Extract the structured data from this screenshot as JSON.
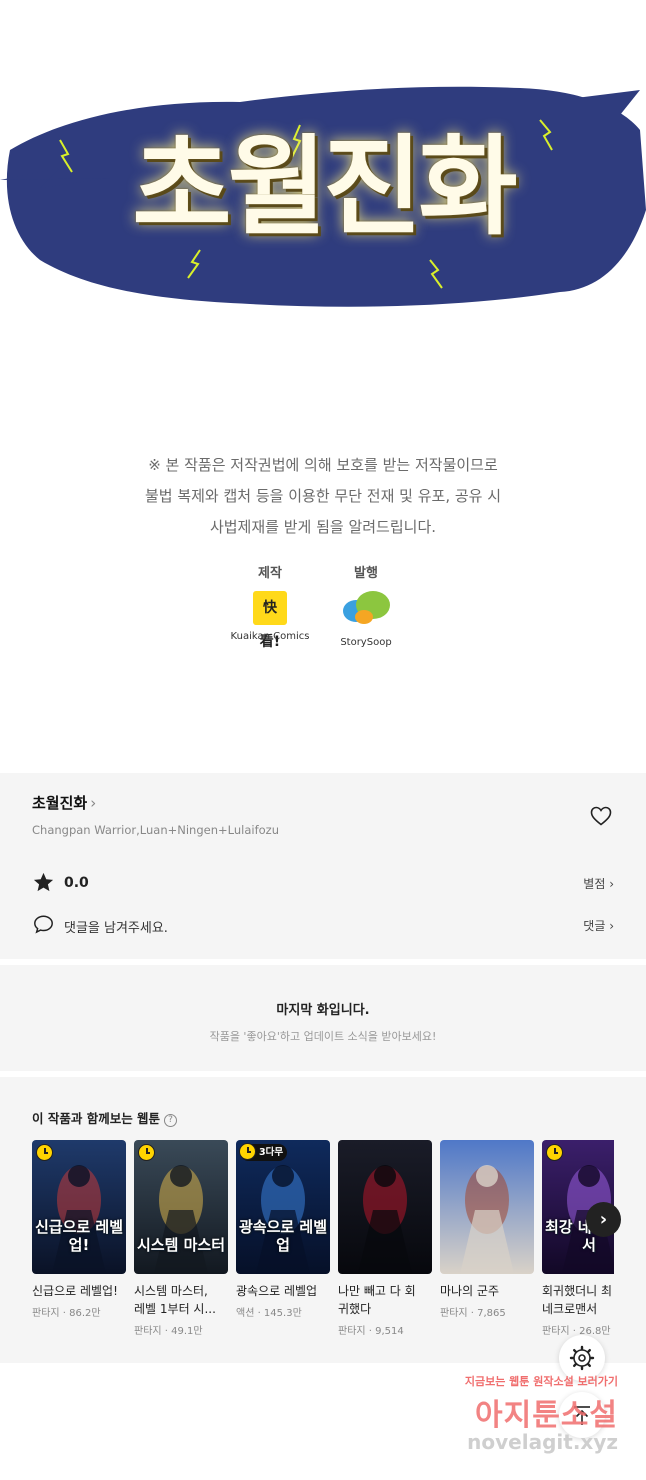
{
  "banner": {
    "title": "초월진화"
  },
  "notice": {
    "lines": [
      "※ 본 작품은 저작권법에 의해 보호를 받는 저작물이므로",
      "불법 복제와 캡처 등을 이용한 무단 전재 및 유포, 공유 시",
      "사법제재를 받게 됨을 알려드립니다."
    ]
  },
  "credits": {
    "production_label": "제작",
    "production_logo_text": "快看!",
    "production_name": "Kuaikan Comics",
    "publisher_label": "발행",
    "publisher_name": "StorySoop"
  },
  "info": {
    "series_title": "초월진화",
    "chevron": "›",
    "authors": "Changpan Warrior,Luan+Ningen+Lulaifozu",
    "rating": "0.0",
    "rate_link": "별점 ›",
    "comment_prompt": "댓글을 남겨주세요.",
    "comment_link": "댓글 ›"
  },
  "last_episode": {
    "title": "마지막 화입니다.",
    "subtitle": "작품을 '좋아요'하고 업데이트 소식을 받아보세요!"
  },
  "recommendations": {
    "heading": "이 작품과 함께보는 웹툰",
    "help": "?",
    "next": "›",
    "items": [
      {
        "title_line1": "신급으로 레벨업!",
        "title_line2": "",
        "meta": "판타지 · 86.2만",
        "cover_text": "신급으로 레벨업!",
        "badge": "clock",
        "colors": [
          "#1f3a6b",
          "#c23a3a",
          "#0a1226"
        ]
      },
      {
        "title_line1": "시스템 마스터,",
        "title_line2": "레벨 1부터 시...",
        "meta": "판타지 · 49.1만",
        "cover_text": "시스템 마스터",
        "badge": "clock",
        "colors": [
          "#3a4a58",
          "#d9b24a",
          "#121820"
        ]
      },
      {
        "title_line1": "광속으로 레벨업",
        "title_line2": "",
        "meta": "액션 · 145.3만",
        "cover_text": "광속으로 레벨업",
        "badge": "wait",
        "badge_text": "3다무",
        "colors": [
          "#0f2a5c",
          "#3a7fd9",
          "#061028"
        ]
      },
      {
        "title_line1": "나만 빼고 다 회",
        "title_line2": "귀했다",
        "meta": "판타지 · 9,514",
        "cover_text": "",
        "badge": "none",
        "colors": [
          "#1a1c28",
          "#b5162a",
          "#07080d"
        ]
      },
      {
        "title_line1": "마나의 군주",
        "title_line2": "",
        "meta": "판타지 · 7,865",
        "cover_text": "",
        "badge": "none",
        "colors": [
          "#4f78c8",
          "#a4472e",
          "#d9d2c8"
        ]
      },
      {
        "title_line1": "회귀했더니 최",
        "title_line2": "네크로맨서",
        "meta": "판타지 · 26.8만",
        "cover_text": "최강 네크로맨서",
        "badge": "clock",
        "colors": [
          "#3b1f6b",
          "#9b5fe0",
          "#120826"
        ]
      }
    ]
  },
  "watermark": {
    "line1": "지금보는 웹툰 원작소설 보러가기",
    "line2": "아지툰소설",
    "line3": "novelagit.xyz"
  }
}
